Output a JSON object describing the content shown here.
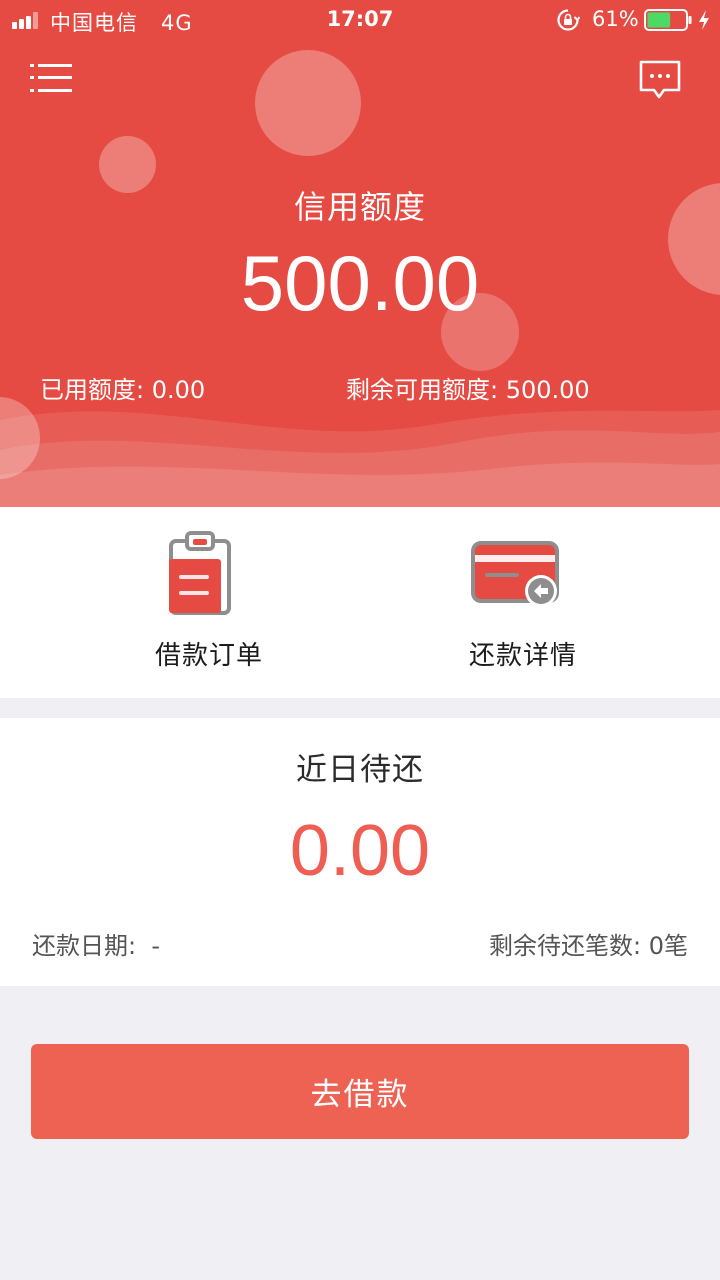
{
  "status_bar": {
    "carrier": "中国电信",
    "network": "4G",
    "time": "17:07",
    "battery": "61%",
    "battery_level": 0.61,
    "battery_color": "#4cd964"
  },
  "header": {
    "menu_icon": "menu-list-icon",
    "message_icon": "chat-bubble-icon",
    "credit_label": "信用额度",
    "credit_amount": "500.00",
    "used_label": "已用额度",
    "used_value": "0.00",
    "remaining_label": "剩余可用额度",
    "remaining_value": "500.00",
    "background_color": "#e54b43"
  },
  "actions": [
    {
      "label": "借款订单",
      "icon": "clipboard-order-icon"
    },
    {
      "label": "还款详情",
      "icon": "card-repay-icon"
    }
  ],
  "due": {
    "title": "近日待还",
    "amount": "0.00",
    "date_label": "还款日期",
    "date_value": "-",
    "count_label": "剩余待还笔数",
    "count_value": "0笔",
    "amount_color": "#ef5e52"
  },
  "borrow_button": {
    "label": "去借款",
    "color": "#ee6253"
  }
}
